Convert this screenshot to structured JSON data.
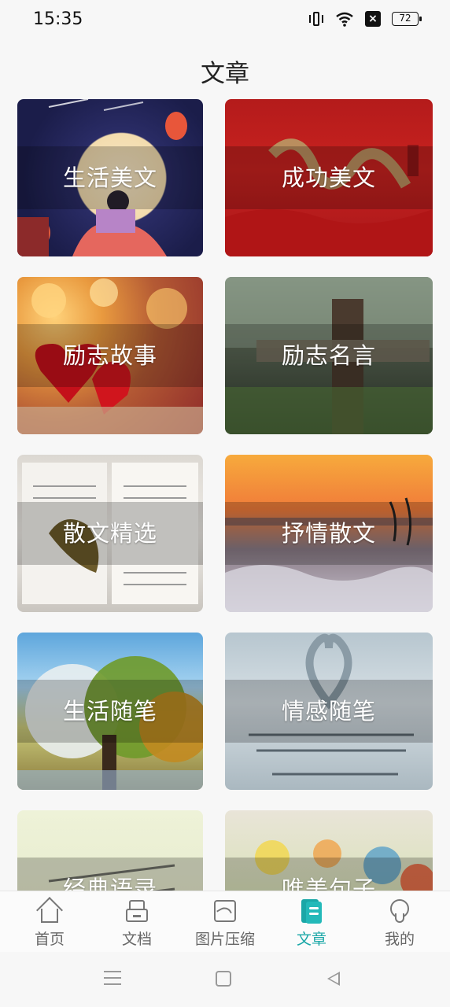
{
  "status_bar": {
    "time": "15:35",
    "battery": "72"
  },
  "page": {
    "title": "文章"
  },
  "cards": [
    {
      "label": "生活美文"
    },
    {
      "label": "成功美文"
    },
    {
      "label": "励志故事"
    },
    {
      "label": "励志名言"
    },
    {
      "label": "散文精选"
    },
    {
      "label": "抒情散文"
    },
    {
      "label": "生活随笔"
    },
    {
      "label": "情感随笔"
    },
    {
      "label": "经典语录"
    },
    {
      "label": "唯美句子"
    }
  ],
  "bottom_nav": {
    "items": [
      {
        "label": "首页",
        "icon": "home-icon"
      },
      {
        "label": "文档",
        "icon": "document-icon"
      },
      {
        "label": "图片压缩",
        "icon": "image-compress-icon"
      },
      {
        "label": "文章",
        "icon": "article-icon",
        "active": true
      },
      {
        "label": "我的",
        "icon": "profile-icon"
      }
    ],
    "active_color": "#1aa7a7"
  }
}
